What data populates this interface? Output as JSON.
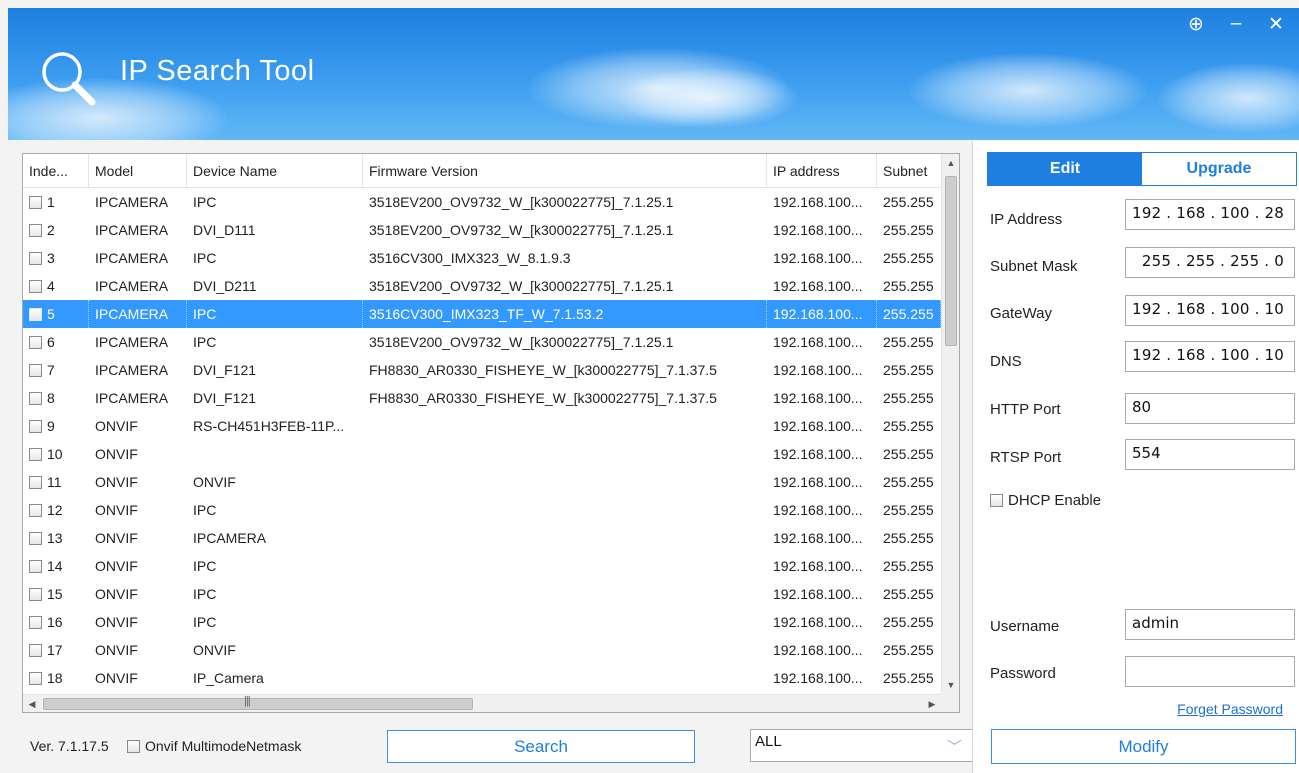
{
  "window": {
    "title": "IP Search Tool",
    "controls": {
      "maximize": "⊕",
      "minimize": "–",
      "close": "✕"
    }
  },
  "table": {
    "columns": [
      "Inde...",
      "Model",
      "Device Name",
      "Firmware Version",
      "IP address",
      "Subnet"
    ],
    "rows": [
      {
        "index": "1",
        "model": "IPCAMERA",
        "name": "IPC",
        "firmware": "3518EV200_OV9732_W_[k300022775]_7.1.25.1",
        "ip": "192.168.100...",
        "subnet": "255.255"
      },
      {
        "index": "2",
        "model": "IPCAMERA",
        "name": "DVI_D111",
        "firmware": "3518EV200_OV9732_W_[k300022775]_7.1.25.1",
        "ip": "192.168.100...",
        "subnet": "255.255"
      },
      {
        "index": "3",
        "model": "IPCAMERA",
        "name": "IPC",
        "firmware": "3516CV300_IMX323_W_8.1.9.3",
        "ip": "192.168.100...",
        "subnet": "255.255"
      },
      {
        "index": "4",
        "model": "IPCAMERA",
        "name": "DVI_D211",
        "firmware": "3518EV200_OV9732_W_[k300022775]_7.1.25.1",
        "ip": "192.168.100...",
        "subnet": "255.255"
      },
      {
        "index": "5",
        "model": "IPCAMERA",
        "name": "IPC",
        "firmware": "3516CV300_IMX323_TF_W_7.1.53.2",
        "ip": "192.168.100...",
        "subnet": "255.255",
        "selected": true
      },
      {
        "index": "6",
        "model": "IPCAMERA",
        "name": "IPC",
        "firmware": "3518EV200_OV9732_W_[k300022775]_7.1.25.1",
        "ip": "192.168.100...",
        "subnet": "255.255"
      },
      {
        "index": "7",
        "model": "IPCAMERA",
        "name": "DVI_F121",
        "firmware": "FH8830_AR0330_FISHEYE_W_[k300022775]_7.1.37.5",
        "ip": "192.168.100...",
        "subnet": "255.255"
      },
      {
        "index": "8",
        "model": "IPCAMERA",
        "name": "DVI_F121",
        "firmware": "FH8830_AR0330_FISHEYE_W_[k300022775]_7.1.37.5",
        "ip": "192.168.100...",
        "subnet": "255.255"
      },
      {
        "index": "9",
        "model": "ONVIF",
        "name": "RS-CH451H3FEB-11P...",
        "firmware": "",
        "ip": "192.168.100...",
        "subnet": "255.255"
      },
      {
        "index": "10",
        "model": "ONVIF",
        "name": "",
        "firmware": "",
        "ip": "192.168.100...",
        "subnet": "255.255"
      },
      {
        "index": "11",
        "model": "ONVIF",
        "name": "ONVIF",
        "firmware": "",
        "ip": "192.168.100...",
        "subnet": "255.255"
      },
      {
        "index": "12",
        "model": "ONVIF",
        "name": "IPC",
        "firmware": "",
        "ip": "192.168.100...",
        "subnet": "255.255"
      },
      {
        "index": "13",
        "model": "ONVIF",
        "name": "IPCAMERA",
        "firmware": "",
        "ip": "192.168.100...",
        "subnet": "255.255"
      },
      {
        "index": "14",
        "model": "ONVIF",
        "name": "IPC",
        "firmware": "",
        "ip": "192.168.100...",
        "subnet": "255.255"
      },
      {
        "index": "15",
        "model": "ONVIF",
        "name": "IPC",
        "firmware": "",
        "ip": "192.168.100...",
        "subnet": "255.255"
      },
      {
        "index": "16",
        "model": "ONVIF",
        "name": "IPC",
        "firmware": "",
        "ip": "192.168.100...",
        "subnet": "255.255"
      },
      {
        "index": "17",
        "model": "ONVIF",
        "name": "ONVIF",
        "firmware": "",
        "ip": "192.168.100...",
        "subnet": "255.255"
      },
      {
        "index": "18",
        "model": "ONVIF",
        "name": "IP_Camera",
        "firmware": "",
        "ip": "192.168.100...",
        "subnet": "255.255"
      }
    ]
  },
  "bottom": {
    "version": "Ver. 7.1.17.5",
    "onvif_option": "Onvif MultimodeNetmask",
    "search_label": "Search",
    "filter_value": "ALL"
  },
  "panel": {
    "tabs": {
      "edit": "Edit",
      "upgrade": "Upgrade"
    },
    "fields": {
      "ip_label": "IP Address",
      "ip_value": "192 . 168 . 100 . 28",
      "mask_label": "Subnet Mask",
      "mask_value": "255 . 255 . 255 .  0",
      "gateway_label": "GateWay",
      "gateway_value": "192 . 168 . 100 . 10",
      "dns_label": "DNS",
      "dns_value": "192 . 168 . 100 . 10",
      "http_label": "HTTP Port",
      "http_value": "80",
      "rtsp_label": "RTSP Port",
      "rtsp_value": "554",
      "dhcp_label": "DHCP Enable",
      "user_label": "Username",
      "user_value": "admin",
      "pass_label": "Password",
      "pass_value": ""
    },
    "forget_label": "Forget Password",
    "modify_label": "Modify"
  },
  "colors": {
    "accent": "#1e7fe0",
    "selection": "#3399ff",
    "link": "#1e6fd6"
  }
}
